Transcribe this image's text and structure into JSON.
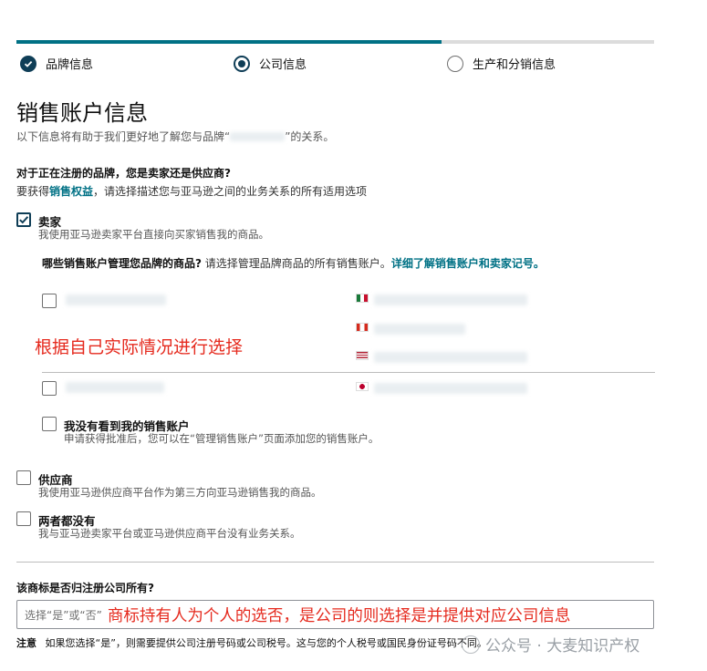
{
  "steps": [
    {
      "label": "品牌信息",
      "state": "done"
    },
    {
      "label": "公司信息",
      "state": "current"
    },
    {
      "label": "生产和分销信息",
      "state": "todo"
    }
  ],
  "progress_fraction": 0.67,
  "section": {
    "title": "销售账户信息",
    "subtitle_before": "以下信息将有助于我们更好地了解您与品牌“",
    "subtitle_after": "”的关系。"
  },
  "question1": {
    "text": "对于正在注册的品牌，您是卖家还是供应商?",
    "hint_prefix": "要获得",
    "hint_link": "销售权益",
    "hint_suffix": "，请选择描述您与亚马逊之间的业务关系的所有适用选项"
  },
  "seller": {
    "label": "卖家",
    "description": "我使用亚马逊卖家平台直接向买家销售我的商品。",
    "checked": true,
    "accounts_question": "哪些销售账户管理您品牌的商品?",
    "accounts_hint": "请选择管理品牌商品的所有销售账户。",
    "accounts_link": "详细了解销售账户和卖家记号。",
    "annotation": "根据自己实际情况进行选择",
    "no_account": {
      "label": "我没有看到我的销售账户",
      "description": "申请获得批准后，您可以在“管理销售账户”页面添加您的销售账户。"
    }
  },
  "supplier": {
    "label": "供应商",
    "description": "我使用亚马逊供应商平台作为第三方向亚马逊销售我的商品。",
    "checked": false
  },
  "neither": {
    "label": "两者都没有",
    "description": "我与亚马逊卖家平台或亚马逊供应商平台没有业务关系。",
    "checked": false
  },
  "question2": {
    "text": "该商标是否归注册公司所有?",
    "placeholder": "选择“是”或“否”",
    "annotation": "商标持有人为个人的选否，是公司的则选择是并提供对应公司信息"
  },
  "footnote": {
    "label": "注意",
    "text": "如果您选择“是”，则需要提供公司注册号码或公司税号。这与您的个人税号或国民身份证号码不同。"
  },
  "watermark": "公众号 · 大麦知识产权",
  "colors": {
    "accent": "#007185",
    "step_icon": "#0f3e57",
    "annotation_red": "#e52a1e"
  }
}
